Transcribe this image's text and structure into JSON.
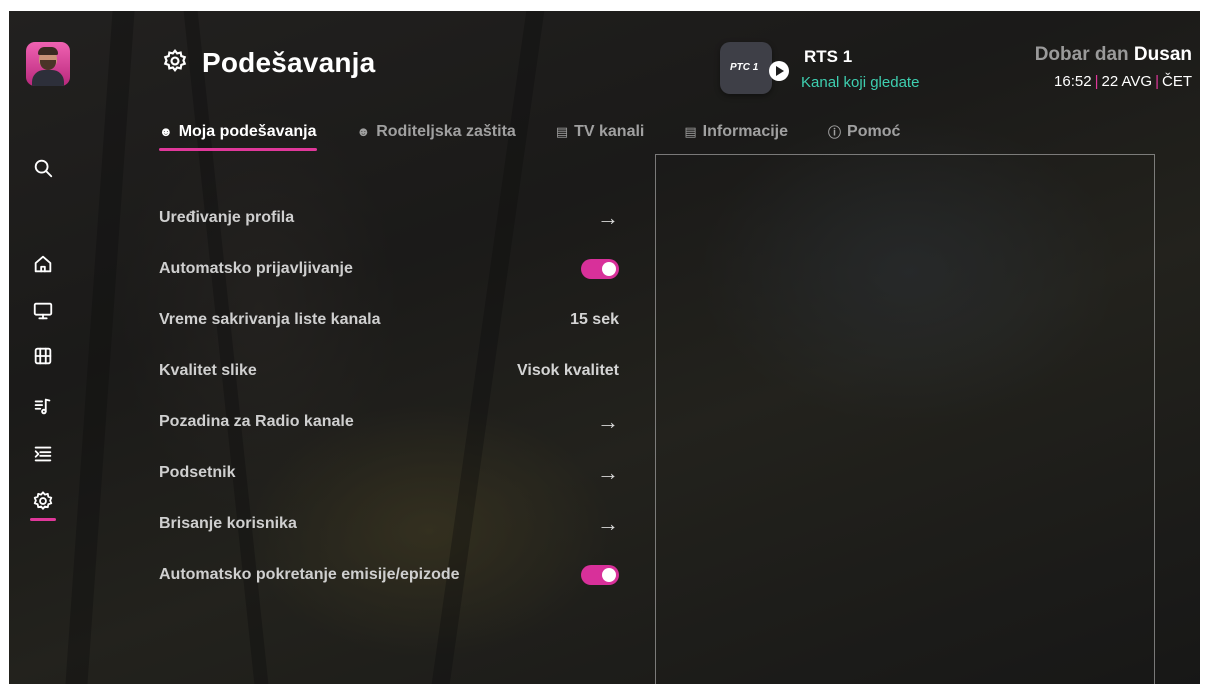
{
  "header": {
    "title": "Podešavanja",
    "icon": "gear-icon"
  },
  "channel": {
    "logo_text": "PTC 1",
    "name": "RTS 1",
    "subtitle": "Kanal koji gledate"
  },
  "greeting": {
    "prefix": "Dobar dan",
    "name": "Dusan"
  },
  "datetime": {
    "time": "16:52",
    "date": "22 AVG",
    "day": "ČET"
  },
  "rail": {
    "items": [
      "search-icon",
      "home-icon",
      "tv-icon",
      "film-icon",
      "radio-icon",
      "guide-icon",
      "gear-icon"
    ],
    "active": "gear-icon"
  },
  "tabs": [
    {
      "label": "Moja podešavanja",
      "icon": "users-icon",
      "active": true
    },
    {
      "label": "Roditeljska zaštita",
      "icon": "users-icon",
      "active": false
    },
    {
      "label": "TV kanali",
      "icon": "list-icon",
      "active": false
    },
    {
      "label": "Informacije",
      "icon": "doc-icon",
      "active": false
    },
    {
      "label": "Pomoć",
      "icon": "help-icon",
      "active": false
    }
  ],
  "settings": [
    {
      "label": "Uređivanje profila",
      "type": "arrow"
    },
    {
      "label": "Automatsko prijavljivanje",
      "type": "toggle",
      "on": true
    },
    {
      "label": "Vreme sakrivanja liste kanala",
      "type": "value",
      "value": "15 sek"
    },
    {
      "label": "Kvalitet slike",
      "type": "value",
      "value": "Visok kvalitet"
    },
    {
      "label": "Pozadina za Radio kanale",
      "type": "arrow"
    },
    {
      "label": "Podsetnik",
      "type": "arrow"
    },
    {
      "label": "Brisanje korisnika",
      "type": "arrow"
    },
    {
      "label": "Automatsko pokretanje emisije/epizode",
      "type": "toggle",
      "on": true
    }
  ],
  "colors": {
    "accent": "#e0389a",
    "channel_sub": "#3ecfb0"
  }
}
